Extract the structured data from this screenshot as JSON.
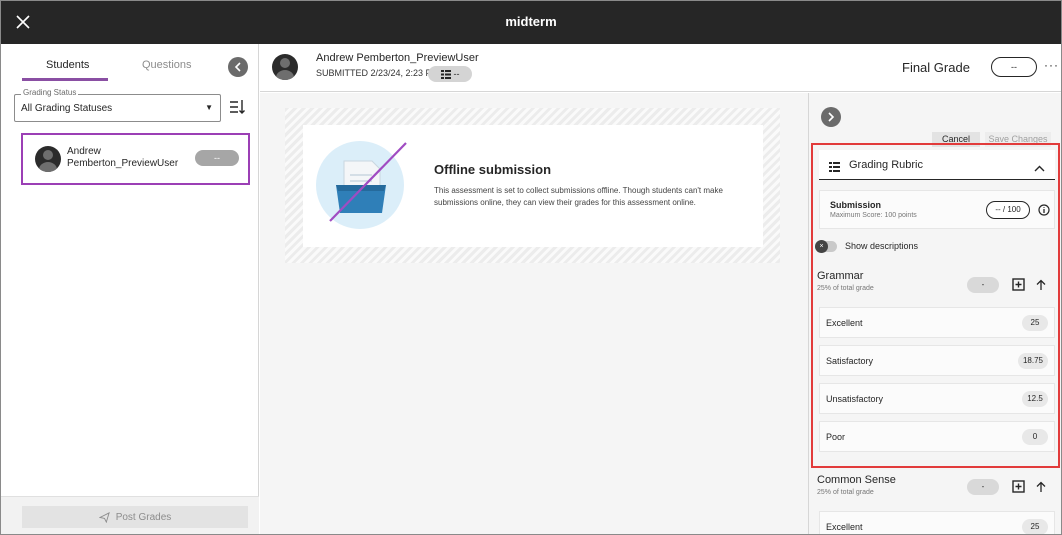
{
  "app": {
    "title": "midterm"
  },
  "left_panel": {
    "tabs": [
      {
        "label": "Students",
        "active": true
      },
      {
        "label": "Questions",
        "active": false
      }
    ],
    "grading_status": {
      "legend": "Grading Status",
      "value": "All Grading Statuses"
    },
    "students": [
      {
        "name": "Andrew Pemberton_PreviewUser",
        "grade": "--"
      }
    ],
    "post_grades_label": "Post Grades"
  },
  "submission": {
    "student_name": "Andrew Pemberton_PreviewUser",
    "submitted": "SUBMITTED 2/23/24, 2:23 PM",
    "attempt_value": "--",
    "final_grade_label": "Final Grade",
    "final_grade_value": "--",
    "more_label": "···"
  },
  "offline": {
    "title": "Offline submission",
    "description": "This assessment is set to collect submissions offline. Though students can't make submissions online, they can view their grades for this assessment online."
  },
  "rubric_panel": {
    "cancel_label": "Cancel",
    "save_label": "Save Changes",
    "title": "Grading Rubric",
    "submission_label": "Submission",
    "max_score": "Maximum Score: 100 points",
    "score_value": "-- / 100",
    "show_descriptions_label": "Show descriptions",
    "criteria": [
      {
        "name": "Grammar",
        "weight": "25% of total grade",
        "value": "-",
        "levels": [
          {
            "name": "Excellent",
            "points": "25"
          },
          {
            "name": "Satisfactory",
            "points": "18.75"
          },
          {
            "name": "Unsatisfactory",
            "points": "12.5"
          },
          {
            "name": "Poor",
            "points": "0"
          }
        ]
      },
      {
        "name": "Common Sense",
        "weight": "25% of total grade",
        "value": "-",
        "levels": [
          {
            "name": "Excellent",
            "points": "25"
          }
        ]
      }
    ]
  },
  "colors": {
    "topbar": "#262626",
    "accent_purple": "#8a4fa3",
    "highlight_red": "#e23b3b"
  }
}
